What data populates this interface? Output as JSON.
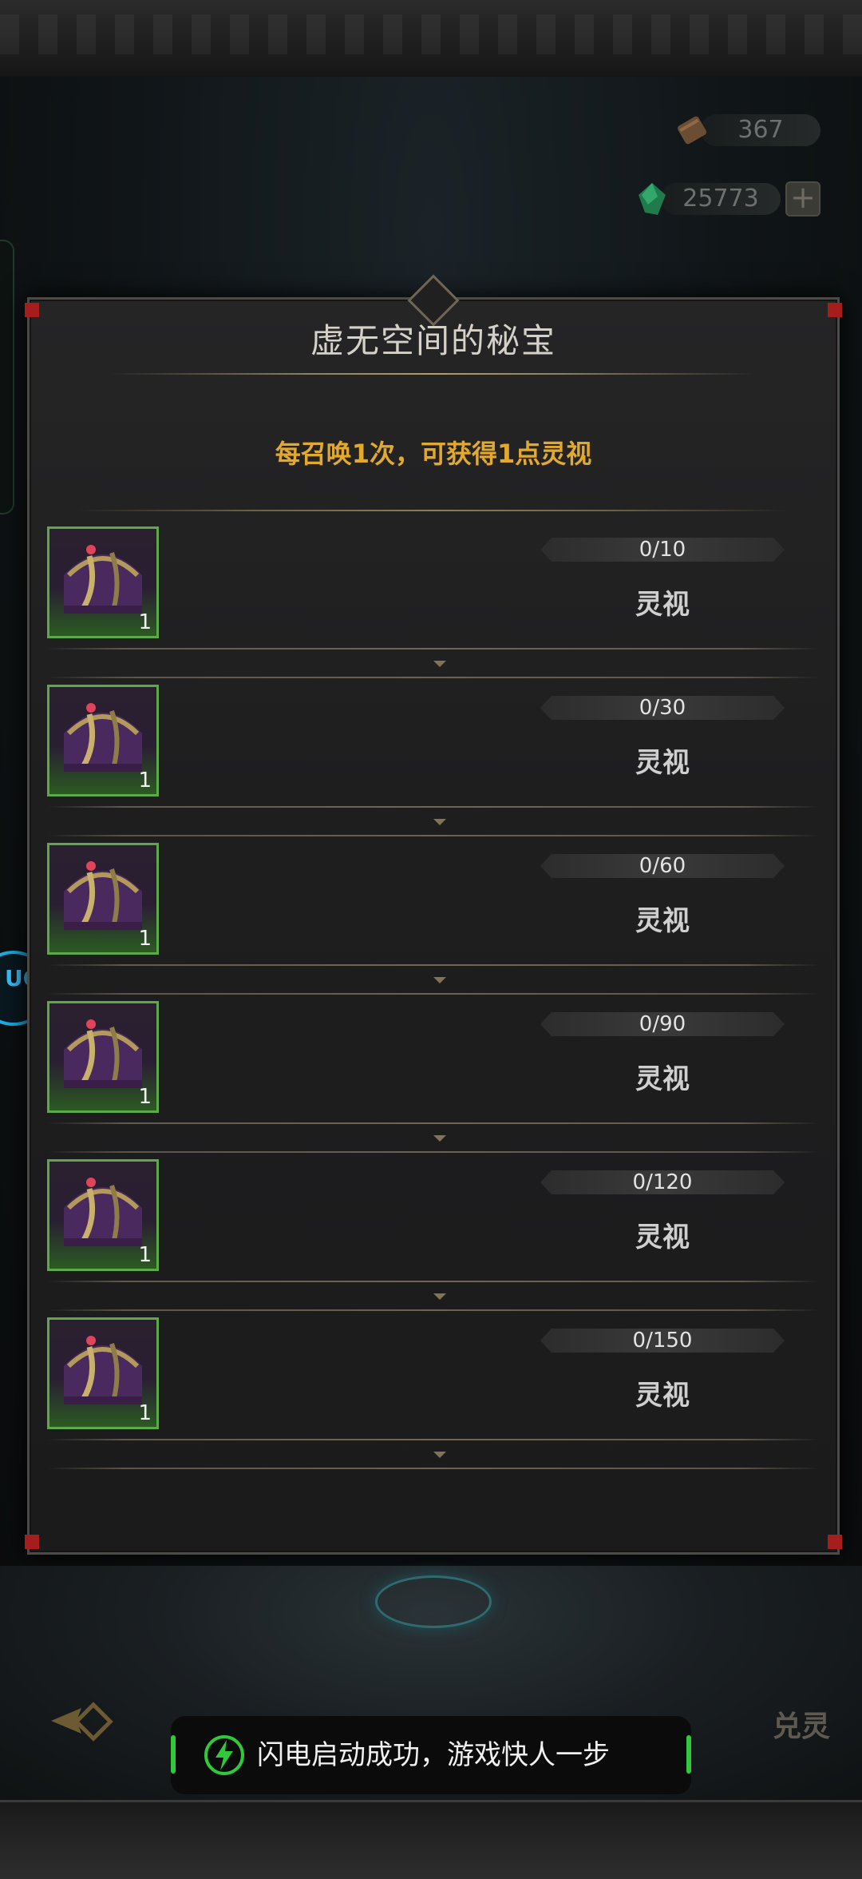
{
  "resources": [
    {
      "icon": "scroll-icon",
      "value": "367"
    },
    {
      "icon": "green-crystal-icon",
      "value": "25773",
      "plus": "+"
    }
  ],
  "side_badge": {
    "label": "UO"
  },
  "panel": {
    "title": "虚无空间的秘宝",
    "subtitle": "每召唤1次，可获得1点灵视",
    "milestones": [
      {
        "progress": "0/10",
        "reward": "灵视",
        "qty": "1"
      },
      {
        "progress": "0/30",
        "reward": "灵视",
        "qty": "1"
      },
      {
        "progress": "0/60",
        "reward": "灵视",
        "qty": "1"
      },
      {
        "progress": "0/90",
        "reward": "灵视",
        "qty": "1"
      },
      {
        "progress": "0/120",
        "reward": "灵视",
        "qty": "1"
      },
      {
        "progress": "0/150",
        "reward": "灵视",
        "qty": "1"
      }
    ]
  },
  "bottom": {
    "right_label": "兑灵"
  },
  "toast": {
    "text": "闪电启动成功，游戏快人一步"
  },
  "colors": {
    "accent_gold": "#e2a92c",
    "chest_border_green": "#5fa84a",
    "toast_green": "#2fc93a"
  }
}
